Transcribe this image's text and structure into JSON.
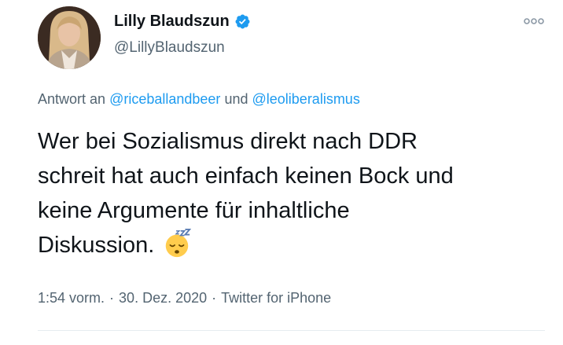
{
  "author": {
    "display_name": "Lilly Blaudszun",
    "handle": "@LillyBlaudszun",
    "verified": true
  },
  "reply": {
    "prefix": "Antwort an",
    "mention1": "@riceballandbeer",
    "conjunction": "und",
    "mention2": "@leoliberalismus"
  },
  "tweet": {
    "lines": [
      "Wer bei Sozialismus direkt nach DDR",
      "schreit hat auch einfach keinen Bock und",
      "keine Argumente für inhaltliche",
      "Diskussion."
    ],
    "emoji": "sleeping-face-icon"
  },
  "meta": {
    "time": "1:54 vorm.",
    "separator": "·",
    "date": "30. Dez. 2020",
    "source": "Twitter for iPhone"
  },
  "colors": {
    "text": "#0f1419",
    "secondary": "#536471",
    "accent": "#1d9bf0"
  }
}
